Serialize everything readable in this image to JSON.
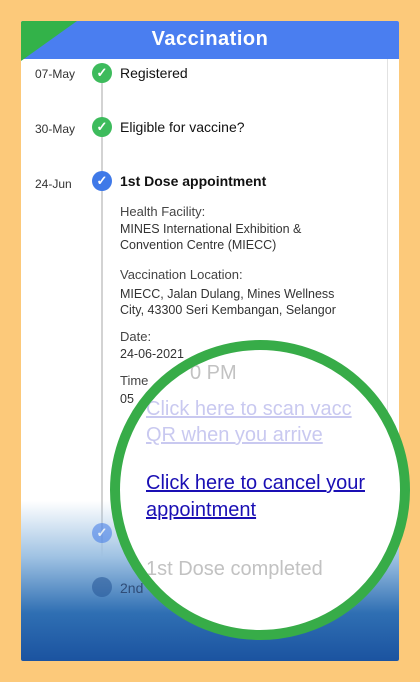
{
  "header": {
    "title": "Vaccination"
  },
  "timeline": [
    {
      "date": "07-May",
      "status": "Registered",
      "state": "done"
    },
    {
      "date": "30-May",
      "status": "Eligible for vaccine?",
      "state": "done"
    },
    {
      "date": "24-Jun",
      "status": "1st Dose appointment",
      "state": "current"
    }
  ],
  "details": {
    "health_facility_label": "Health Facility:",
    "health_facility_line1": "MINES International Exhibition &",
    "health_facility_line2": "Convention Centre (MIECC)",
    "location_label": "Vaccination Location:",
    "location_line1": "MIECC, Jalan Dulang, Mines Wellness",
    "location_line2": "City, 43300 Seri Kembangan, Selangor",
    "date_label": "Date:",
    "date_value": "24-06-2021",
    "time_label": "Time",
    "time_value": "05"
  },
  "below": {
    "next_label": "2nd"
  },
  "zoom": {
    "time_partial": "0 PM",
    "scan_line1": "Click here to scan vacc",
    "scan_line2": "QR when you arrive",
    "cancel_line1": "Click here to cancel your",
    "cancel_line2": "appointment",
    "completed": "1st Dose completed"
  },
  "colors": {
    "header": "#4a7ef0",
    "done": "#3dbb5c",
    "current": "#3f79e8",
    "ring": "#37ac48",
    "background": "#fcc97a"
  }
}
